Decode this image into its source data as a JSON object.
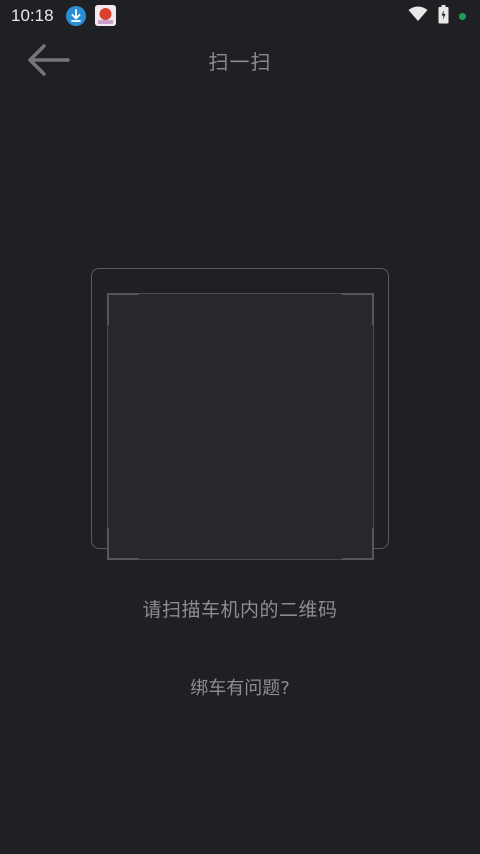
{
  "status_bar": {
    "time": "10:18",
    "icons": [
      "download-icon",
      "app-notification-icon",
      "wifi-icon",
      "battery-icon",
      "status-dot-icon"
    ]
  },
  "header": {
    "back_icon": "arrow-left-icon",
    "title": "扫一扫"
  },
  "scanner": {
    "hint": "请扫描车机内的二维码"
  },
  "footer": {
    "bind_problem_link": "绑车有问题?"
  },
  "colors": {
    "background": "#1f2024",
    "scan_area": "#27282c",
    "text_muted": "#8c8d90",
    "status_dot": "#1f9e57",
    "download_badge": "#2a8fd6"
  }
}
